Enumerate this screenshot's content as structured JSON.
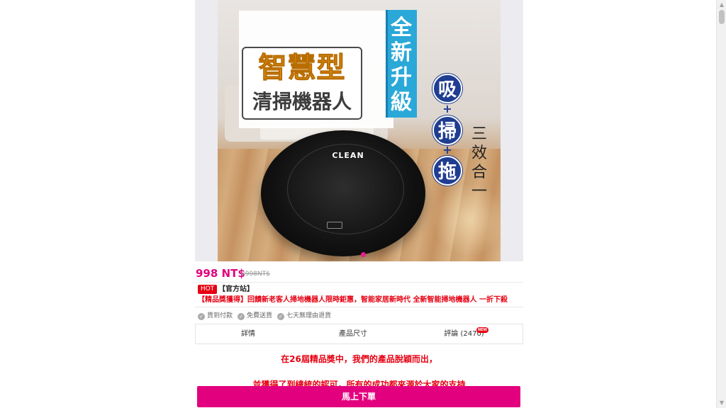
{
  "hero": {
    "title_line1": "智慧型",
    "title_line2": "清掃機器人",
    "upgrade_text": "全新升級",
    "feature_1": "吸",
    "feature_2": "掃",
    "feature_3": "拖",
    "plus": "+",
    "three_in_one": "三效合一",
    "robot_logo": "CLEAN",
    "carousel_active_index": 1
  },
  "price": {
    "current": "998 NT$",
    "original": "2998NT$"
  },
  "store": {
    "hot_badge": "HOT",
    "label": "【官方站】",
    "promo": "【精品獎獲得】回饋新老客人掃地機器人限時鉅惠，智能家居新時代 全新智能掃地機器人 一折下殺"
  },
  "badges": [
    {
      "label": "貨到付款",
      "icon": "check-circle-icon"
    },
    {
      "label": "免費送貨",
      "icon": "check-circle-icon"
    },
    {
      "label": "七天無理由退貨",
      "icon": "check-circle-icon"
    }
  ],
  "tabs": {
    "details": "詳情",
    "size": "產品尺寸",
    "reviews": "評論 (2470)",
    "new_tag": "NEW"
  },
  "content": {
    "line1": "在26屆精品獎中，我們的產品脫穎而出，",
    "line2": "並獲得了到總統的認可，所有的成功都來源於大家的支持"
  },
  "order_button": "馬上下單",
  "colors": {
    "accent": "#e3007f",
    "promo_red": "#e60012",
    "hot_red": "#e60012",
    "feature_blue": "#1f3d91",
    "banner_blue": "#2aa8d8"
  }
}
